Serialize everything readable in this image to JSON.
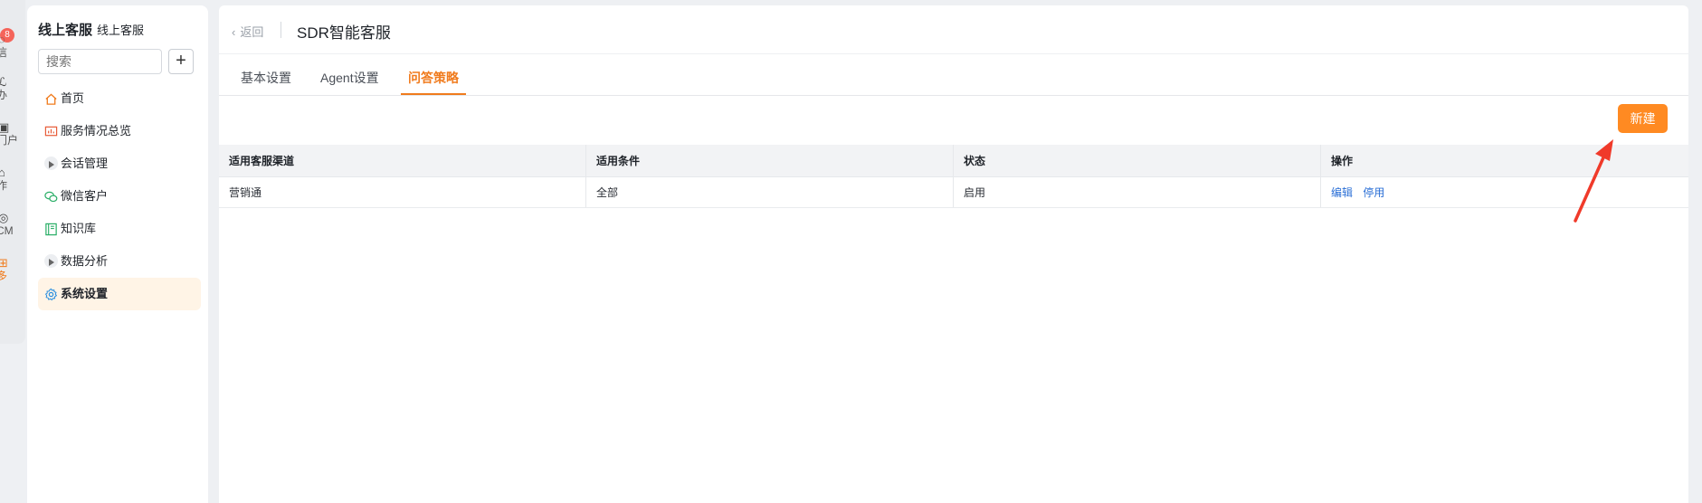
{
  "rail": {
    "badge": "8",
    "items": [
      {
        "glyph": "◌",
        "label": "信"
      },
      {
        "glyph": "ℒ",
        "label": "办"
      },
      {
        "glyph": "▣",
        "label": "门户"
      },
      {
        "glyph": "⌂",
        "label": "作"
      },
      {
        "glyph": "◎",
        "label": "CM"
      },
      {
        "glyph": "⊞",
        "label": "多"
      }
    ]
  },
  "sidebar": {
    "title": "线上客服",
    "subtitle": "线上客服",
    "search_placeholder": "搜索",
    "add_label": "+",
    "items": [
      {
        "label": "首页",
        "icon": "home-icon"
      },
      {
        "label": "服务情况总览",
        "icon": "monitor-chart-icon"
      },
      {
        "label": "会话管理",
        "icon": "expand-triangle-icon"
      },
      {
        "label": "微信客户",
        "icon": "wechat-icon"
      },
      {
        "label": "知识库",
        "icon": "book-icon"
      },
      {
        "label": "数据分析",
        "icon": "expand-triangle-icon"
      },
      {
        "label": "系统设置",
        "icon": "gear-icon"
      }
    ]
  },
  "header": {
    "back_label": "返回",
    "title": "SDR智能客服"
  },
  "tabs": [
    {
      "label": "基本设置"
    },
    {
      "label": "Agent设置"
    },
    {
      "label": "问答策略"
    }
  ],
  "toolbar": {
    "new_label": "新建"
  },
  "table": {
    "columns": [
      "适用客服渠道",
      "适用条件",
      "状态",
      "操作"
    ],
    "rows": [
      {
        "channel": "营销通",
        "condition": "全部",
        "status": "启用",
        "actions": [
          "编辑",
          "停用"
        ]
      }
    ]
  },
  "colors": {
    "accent": "#f07b1d",
    "button": "#ff8a22",
    "link": "#2b6fd6",
    "arrow": "#f03a2a"
  }
}
